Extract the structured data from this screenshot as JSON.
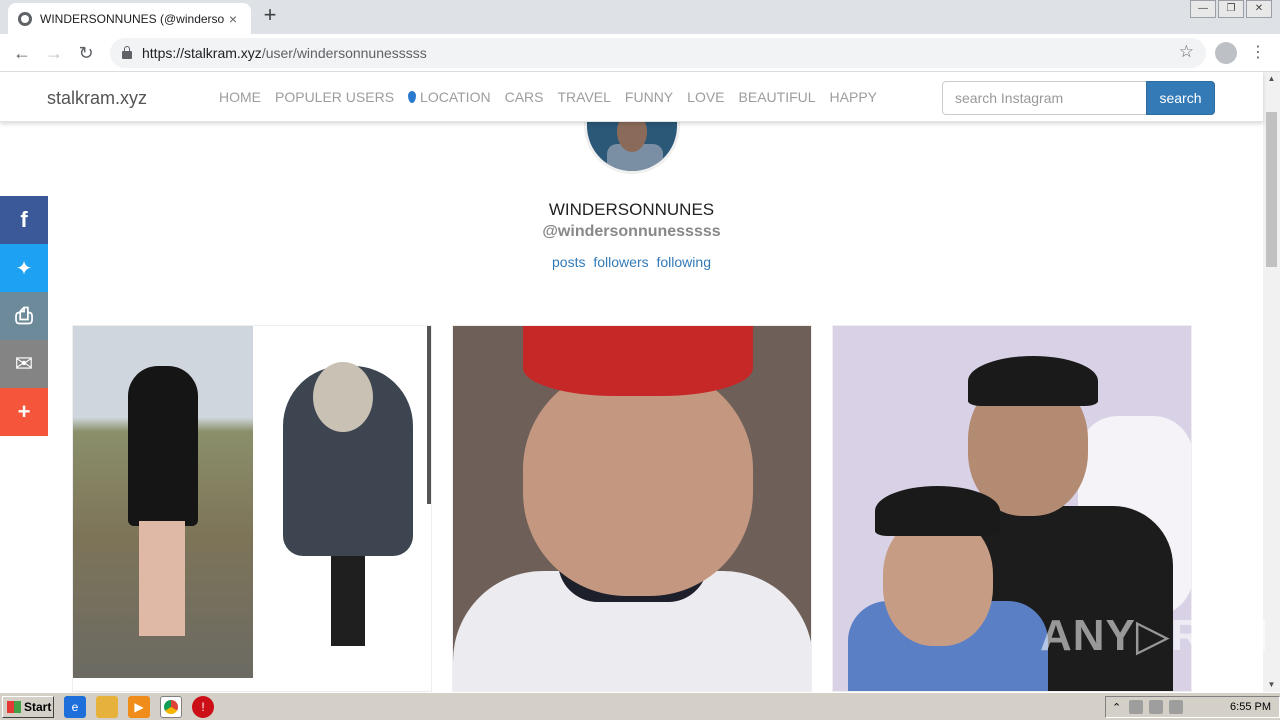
{
  "browser": {
    "tab_title": "WINDERSONNUNES (@windersonnu",
    "tab_close": "×",
    "new_tab": "+",
    "url_host": "https://stalkram.xyz",
    "url_path": "/user/windersonnunesssss",
    "back": "←",
    "forward": "→",
    "reload": "↻",
    "star": "☆",
    "menu": "⋮",
    "window_controls": [
      "—",
      "❐",
      "✕"
    ]
  },
  "site": {
    "brand": "stalkram.xyz",
    "nav": [
      "HOME",
      "POPULER USERS",
      "LOCATION",
      "CARS",
      "TRAVEL",
      "FUNNY",
      "LOVE",
      "BEAUTIFUL",
      "HAPPY"
    ],
    "search_placeholder": "search Instagram",
    "search_button": "search"
  },
  "profile": {
    "name": "WINDERSONNUNES",
    "handle": "@windersonnunesssss",
    "stats": [
      "posts",
      "followers",
      "following"
    ]
  },
  "share": [
    {
      "name": "facebook",
      "glyph": "f",
      "color": "#3b5998"
    },
    {
      "name": "twitter",
      "glyph": "🐦",
      "color": "#1da1f2"
    },
    {
      "name": "print",
      "glyph": "⎙",
      "color": "#6d8a9b"
    },
    {
      "name": "email",
      "glyph": "✉",
      "color": "#848484"
    },
    {
      "name": "more",
      "glyph": "+",
      "color": "#f4553b"
    }
  ],
  "watermark": "ANY▷RUN",
  "taskbar": {
    "start": "Start",
    "clock": "6:55 PM"
  }
}
